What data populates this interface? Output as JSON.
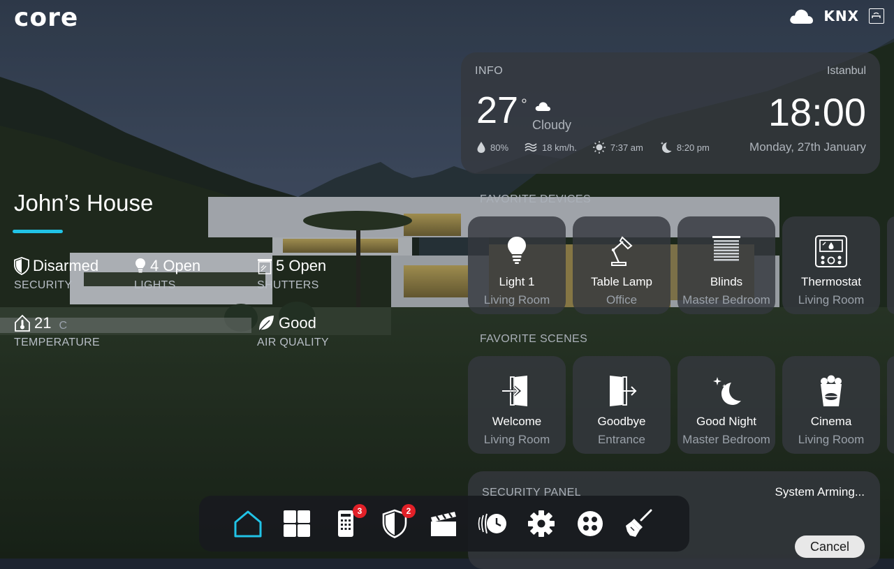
{
  "brand": {
    "logo_text": "core",
    "protocol": "KNX"
  },
  "house": {
    "title": "John’s House",
    "stats": {
      "security": {
        "value": "Disarmed",
        "label": "SECURITY"
      },
      "lights": {
        "value": "4 Open",
        "label": "LIGHTS"
      },
      "shutters": {
        "value": "5 Open",
        "label": "SHUTTERS"
      },
      "temperature": {
        "value": "21",
        "unit": "C",
        "label": "TEMPERATURE"
      },
      "air_quality": {
        "value": "Good",
        "label": "AIR QUALITY"
      }
    }
  },
  "info": {
    "header": "INFO",
    "city": "Istanbul",
    "temperature": "27",
    "degree_symbol": "°",
    "condition": "Cloudy",
    "humidity": "80%",
    "wind": "18 km/h.",
    "sunrise": "7:37 am",
    "sunset": "8:20 pm",
    "time": "18:00",
    "date": "Monday, 27th January"
  },
  "favorite_devices": {
    "title": "FAVORITE DEVICES",
    "items": [
      {
        "name": "Light 1",
        "room": "Living Room",
        "icon": "lightbulb-icon"
      },
      {
        "name": "Table Lamp",
        "room": "Office",
        "icon": "desk-lamp-icon"
      },
      {
        "name": "Blinds",
        "room": "Master Bedroom",
        "icon": "blinds-icon"
      },
      {
        "name": "Thermostat",
        "room": "Living Room",
        "icon": "thermostat-icon"
      }
    ]
  },
  "favorite_scenes": {
    "title": "FAVORITE SCENES",
    "items": [
      {
        "name": "Welcome",
        "room": "Living Room",
        "icon": "door-enter-icon"
      },
      {
        "name": "Goodbye",
        "room": "Entrance",
        "icon": "door-exit-icon"
      },
      {
        "name": "Good Night",
        "room": "Master Bedroom",
        "icon": "moon-stars-icon"
      },
      {
        "name": "Cinema",
        "room": "Living Room",
        "icon": "popcorn-icon"
      }
    ]
  },
  "security_panel": {
    "title": "SECURITY PANEL",
    "status": "System Arming...",
    "cancel_label": "Cancel"
  },
  "dock": {
    "items": [
      {
        "icon": "home-icon",
        "active": true
      },
      {
        "icon": "grid-icon"
      },
      {
        "icon": "intercom-icon",
        "badge": "3"
      },
      {
        "icon": "shield-icon",
        "badge": "2"
      },
      {
        "icon": "clapperboard-icon"
      },
      {
        "icon": "schedule-icon"
      },
      {
        "icon": "gear-icon"
      },
      {
        "icon": "remote-icon"
      },
      {
        "icon": "cleaning-icon"
      }
    ]
  },
  "colors": {
    "accent": "#21c3e6",
    "badge": "#e22028",
    "card": "#34383e"
  }
}
